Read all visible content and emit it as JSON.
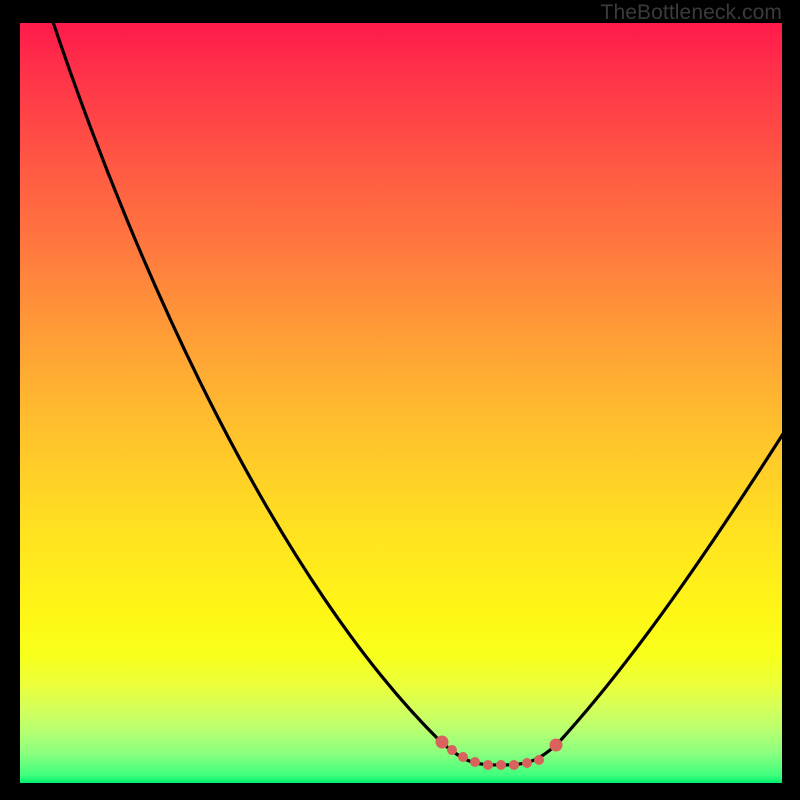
{
  "watermark": "TheBottleneck.com",
  "colors": {
    "curve": "#000000",
    "marker": "#d9625d",
    "gradient_top": "#ff1a4a",
    "gradient_bottom": "#00ef6d",
    "frame": "#000000"
  },
  "chart_data": {
    "type": "line",
    "title": "",
    "xlabel": "",
    "ylabel": "",
    "xlim": [
      0,
      1
    ],
    "ylim": [
      0,
      1
    ],
    "grid": false,
    "legend": false,
    "notes": "Axes are unlabeled; x and y normalized 0–1. Curve is a single black line falling from top-left to a flat minimum then rising to the right. Salmon dots highlight the flat-minimum region. Background is a vertical red→yellow→green gradient inside a black border. Watermark text sits at top-right.",
    "series": [
      {
        "name": "curve",
        "color": "#000000",
        "x": [
          0.04,
          0.1,
          0.18,
          0.26,
          0.34,
          0.42,
          0.5,
          0.555,
          0.59,
          0.615,
          0.645,
          0.675,
          0.71,
          0.78,
          0.86,
          0.94,
          1.0
        ],
        "y": [
          1.02,
          0.84,
          0.66,
          0.5,
          0.36,
          0.23,
          0.12,
          0.055,
          0.03,
          0.023,
          0.023,
          0.03,
          0.055,
          0.14,
          0.28,
          0.4,
          0.48
        ]
      }
    ],
    "highlight_region": {
      "name": "optimal-range-dots",
      "color": "#d9625d",
      "x": [
        0.555,
        0.568,
        0.582,
        0.598,
        0.615,
        0.632,
        0.649,
        0.666,
        0.682,
        0.704
      ],
      "y": [
        0.054,
        0.044,
        0.034,
        0.028,
        0.023,
        0.023,
        0.023,
        0.026,
        0.031,
        0.05
      ]
    }
  }
}
